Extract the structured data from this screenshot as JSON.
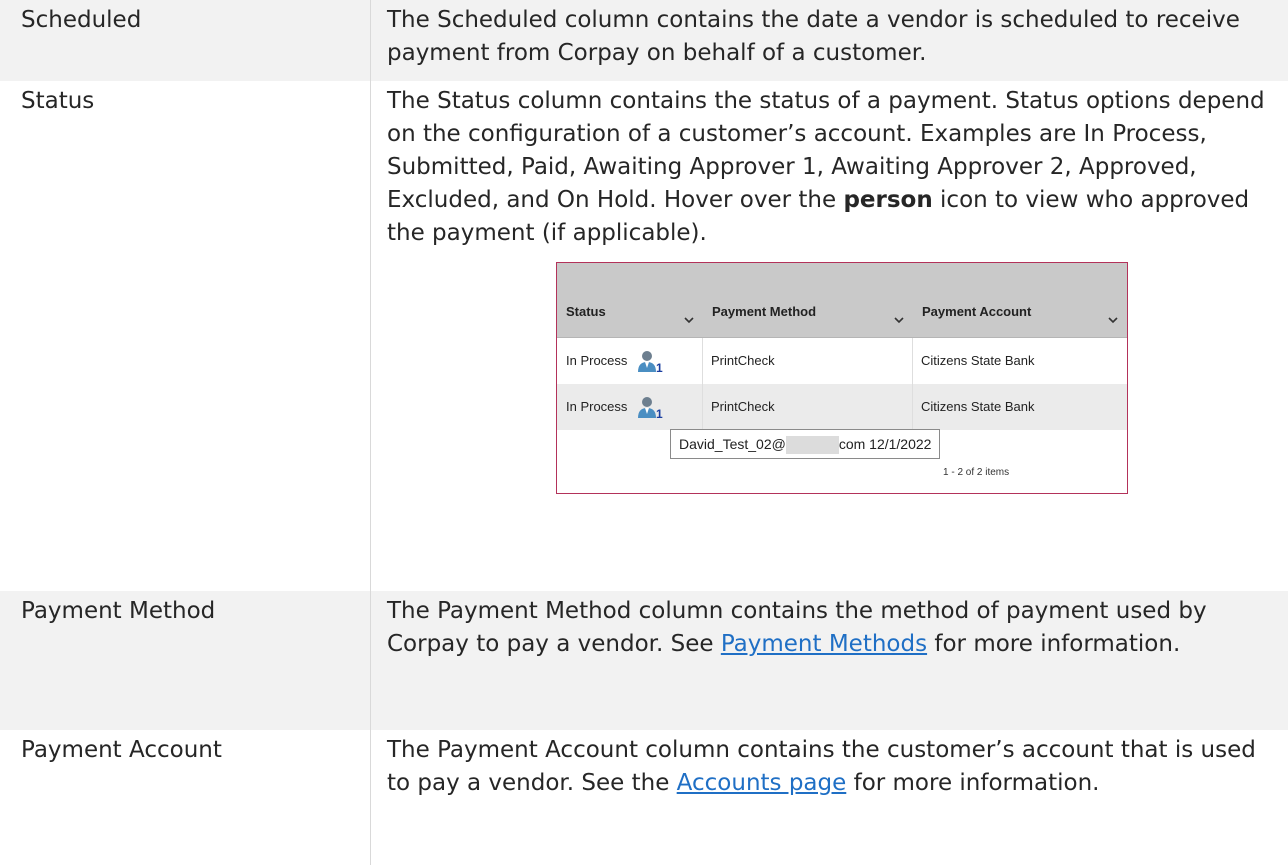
{
  "rows": [
    {
      "term": "Scheduled",
      "description": "The Scheduled column contains the date a vendor is scheduled to receive payment from Corpay on behalf of a customer."
    },
    {
      "term": "Status",
      "description_before": "The Status column contains the status of a payment. Status options depend on the configuration of a customer’s account. Examples are In Process, Submitted, Paid, Awaiting Approver 1, Awaiting Approver 2, Approved, Excluded, and On Hold. Hover over the ",
      "description_bold": "person",
      "description_after": " icon to view who approved the payment (if applicable)."
    },
    {
      "term": "Payment Method",
      "description_before": "The Payment Method column contains the method of payment used by Corpay to pay a vendor. See ",
      "link": "Payment Methods",
      "description_after": " for more information."
    },
    {
      "term": "Payment Account",
      "description_before": "The Payment Account column contains the customer’s account that is used to pay a vendor. See the ",
      "link": "Accounts page",
      "description_after": " for more information."
    }
  ],
  "screenshot": {
    "columns": [
      "Status",
      "Payment Method",
      "Payment Account"
    ],
    "grid_rows": [
      {
        "status": "In Process",
        "approver_count": "1",
        "method": "PrintCheck",
        "account": "Citizens State Bank"
      },
      {
        "status": "In Process",
        "approver_count": "1",
        "method": "PrintCheck",
        "account": "Citizens State Bank"
      }
    ],
    "tooltip_prefix": "David_Test_02@",
    "tooltip_suffix": "com 12/1/2022",
    "pager": "1 - 2 of 2 items"
  },
  "colors": {
    "link": "#1f6fc5",
    "row_alt": "#f2f2f2",
    "screenshot_border": "#b3325a",
    "grid_header": "#c9c9c9"
  },
  "icons": [
    "chevron-down-icon",
    "person-icon"
  ]
}
